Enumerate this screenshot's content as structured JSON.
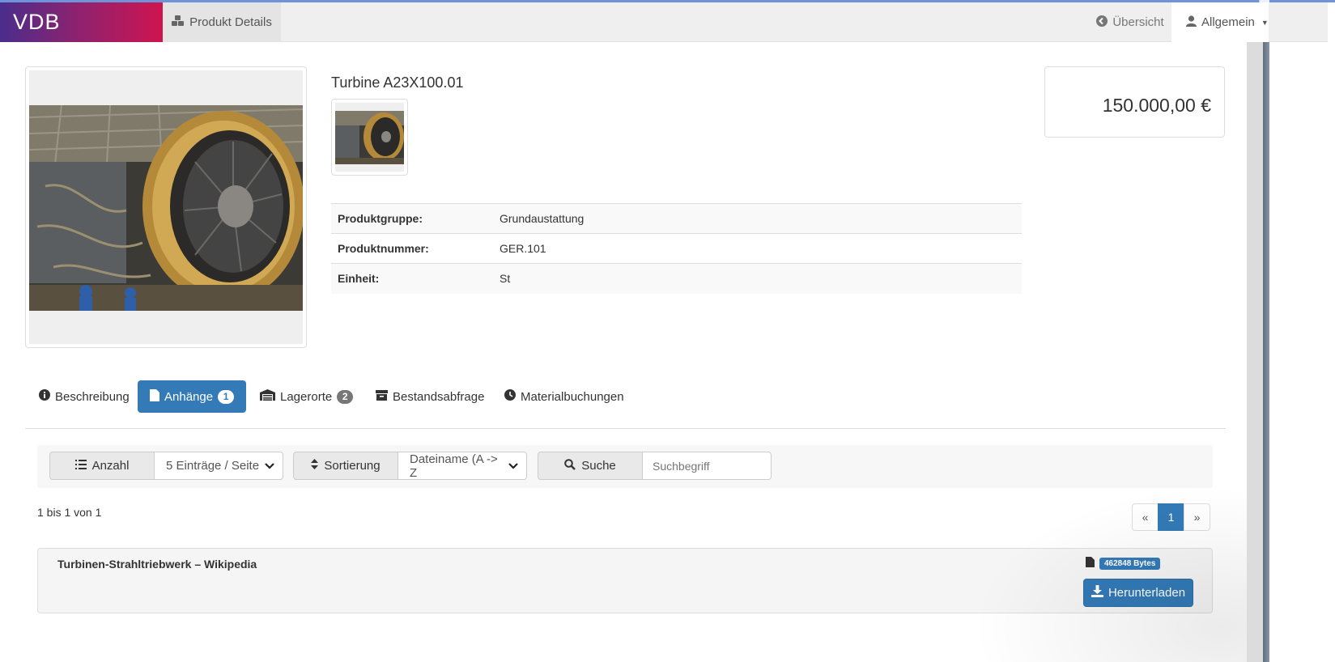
{
  "navbar": {
    "brand": "VDB",
    "active_item": "Produkt Details",
    "overview_link": "Übersicht",
    "user_menu": "Allgemein",
    "icons": {
      "active_item": "cubes-icon",
      "overview_link": "circle-arrow-left-icon",
      "user_menu": "user-icon"
    }
  },
  "product": {
    "title": "Turbine A23X100.01",
    "price": "150.000,00 €",
    "details": [
      {
        "label": "Produktgruppe:",
        "value": "Grundaustattung"
      },
      {
        "label": "Produktnummer:",
        "value": "GER.101"
      },
      {
        "label": "Einheit:",
        "value": "St"
      }
    ]
  },
  "tabs": [
    {
      "label": "Beschreibung",
      "icon": "info-circle-icon",
      "active": false
    },
    {
      "label": "Anhänge",
      "icon": "file-icon",
      "badge": "1",
      "active": true
    },
    {
      "label": "Lagerorte",
      "icon": "warehouse-icon",
      "badge": "2",
      "active": false
    },
    {
      "label": "Bestandsabfrage",
      "icon": "archive-icon",
      "active": false
    },
    {
      "label": "Materialbuchungen",
      "icon": "clock-icon",
      "active": false
    }
  ],
  "toolbar": {
    "count_label": "Anzahl",
    "count_value": "5 Einträge / Seite",
    "sort_label": "Sortierung",
    "sort_value": "Dateiname (A -> Z",
    "search_label": "Suche",
    "search_placeholder": "Suchbegriff"
  },
  "results": {
    "summary": "1 bis 1 von 1",
    "pager": {
      "prev": "«",
      "current": "1",
      "next": "»"
    }
  },
  "attachments": [
    {
      "title": "Turbinen-Strahltriebwerk – Wikipedia",
      "size": "462848 Bytes",
      "download_label": "Herunterladen"
    }
  ],
  "colors": {
    "primary": "#337ab7",
    "brand_gradient_start": "#4a2d8c",
    "brand_gradient_end": "#cf1450"
  }
}
